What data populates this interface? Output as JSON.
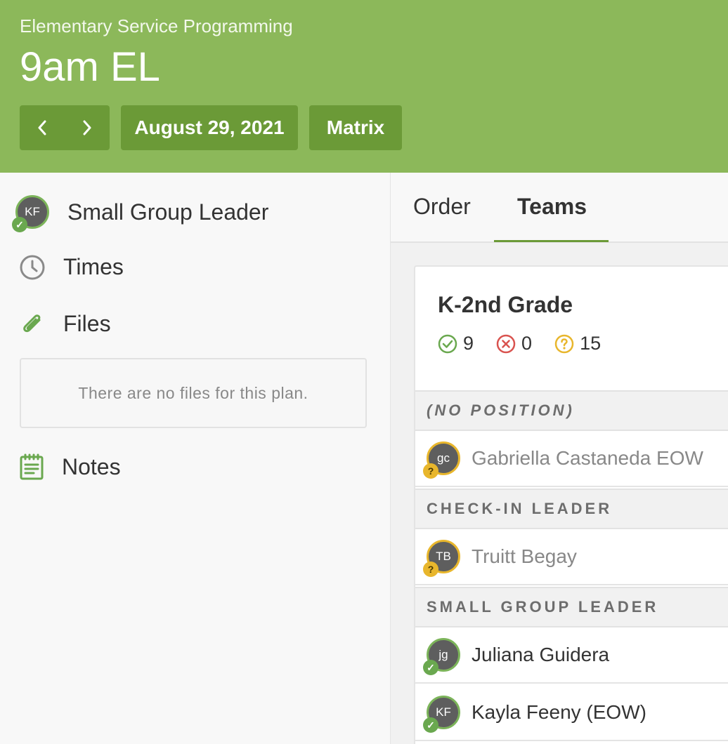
{
  "header": {
    "subtitle": "Elementary Service Programming",
    "title": "9am EL",
    "prev_icon": "‹",
    "next_icon": "›",
    "date": "August 29, 2021",
    "matrix": "Matrix",
    "color": "#8cb85a",
    "button_color": "#6b9a37"
  },
  "sidebar": {
    "role": {
      "initials": "KF",
      "label": "Small Group Leader",
      "status": "confirmed"
    },
    "times_label": "Times",
    "files_label": "Files",
    "files_empty": "There are no files for this plan.",
    "notes_label": "Notes"
  },
  "tabs": {
    "order": "Order",
    "teams": "Teams",
    "active": "Teams"
  },
  "team": {
    "name": "K-2nd Grade",
    "counts": {
      "confirmed": "9",
      "declined": "0",
      "pending": "15"
    },
    "sections": [
      {
        "title": "(NO POSITION)",
        "people": [
          {
            "initials": "gc",
            "name": "Gabriella Castaneda EOW",
            "status": "pending"
          }
        ]
      },
      {
        "title": "CHECK-IN LEADER",
        "people": [
          {
            "initials": "TB",
            "name": "Truitt Begay",
            "status": "pending"
          }
        ]
      },
      {
        "title": "SMALL GROUP LEADER",
        "people": [
          {
            "initials": "jg",
            "name": "Juliana Guidera",
            "status": "confirmed"
          },
          {
            "initials": "KF",
            "name": "Kayla Feeny (EOW)",
            "status": "confirmed"
          }
        ]
      }
    ]
  },
  "colors": {
    "confirmed": "#6aa84f",
    "declined": "#d9534f",
    "pending": "#e8b62c"
  }
}
